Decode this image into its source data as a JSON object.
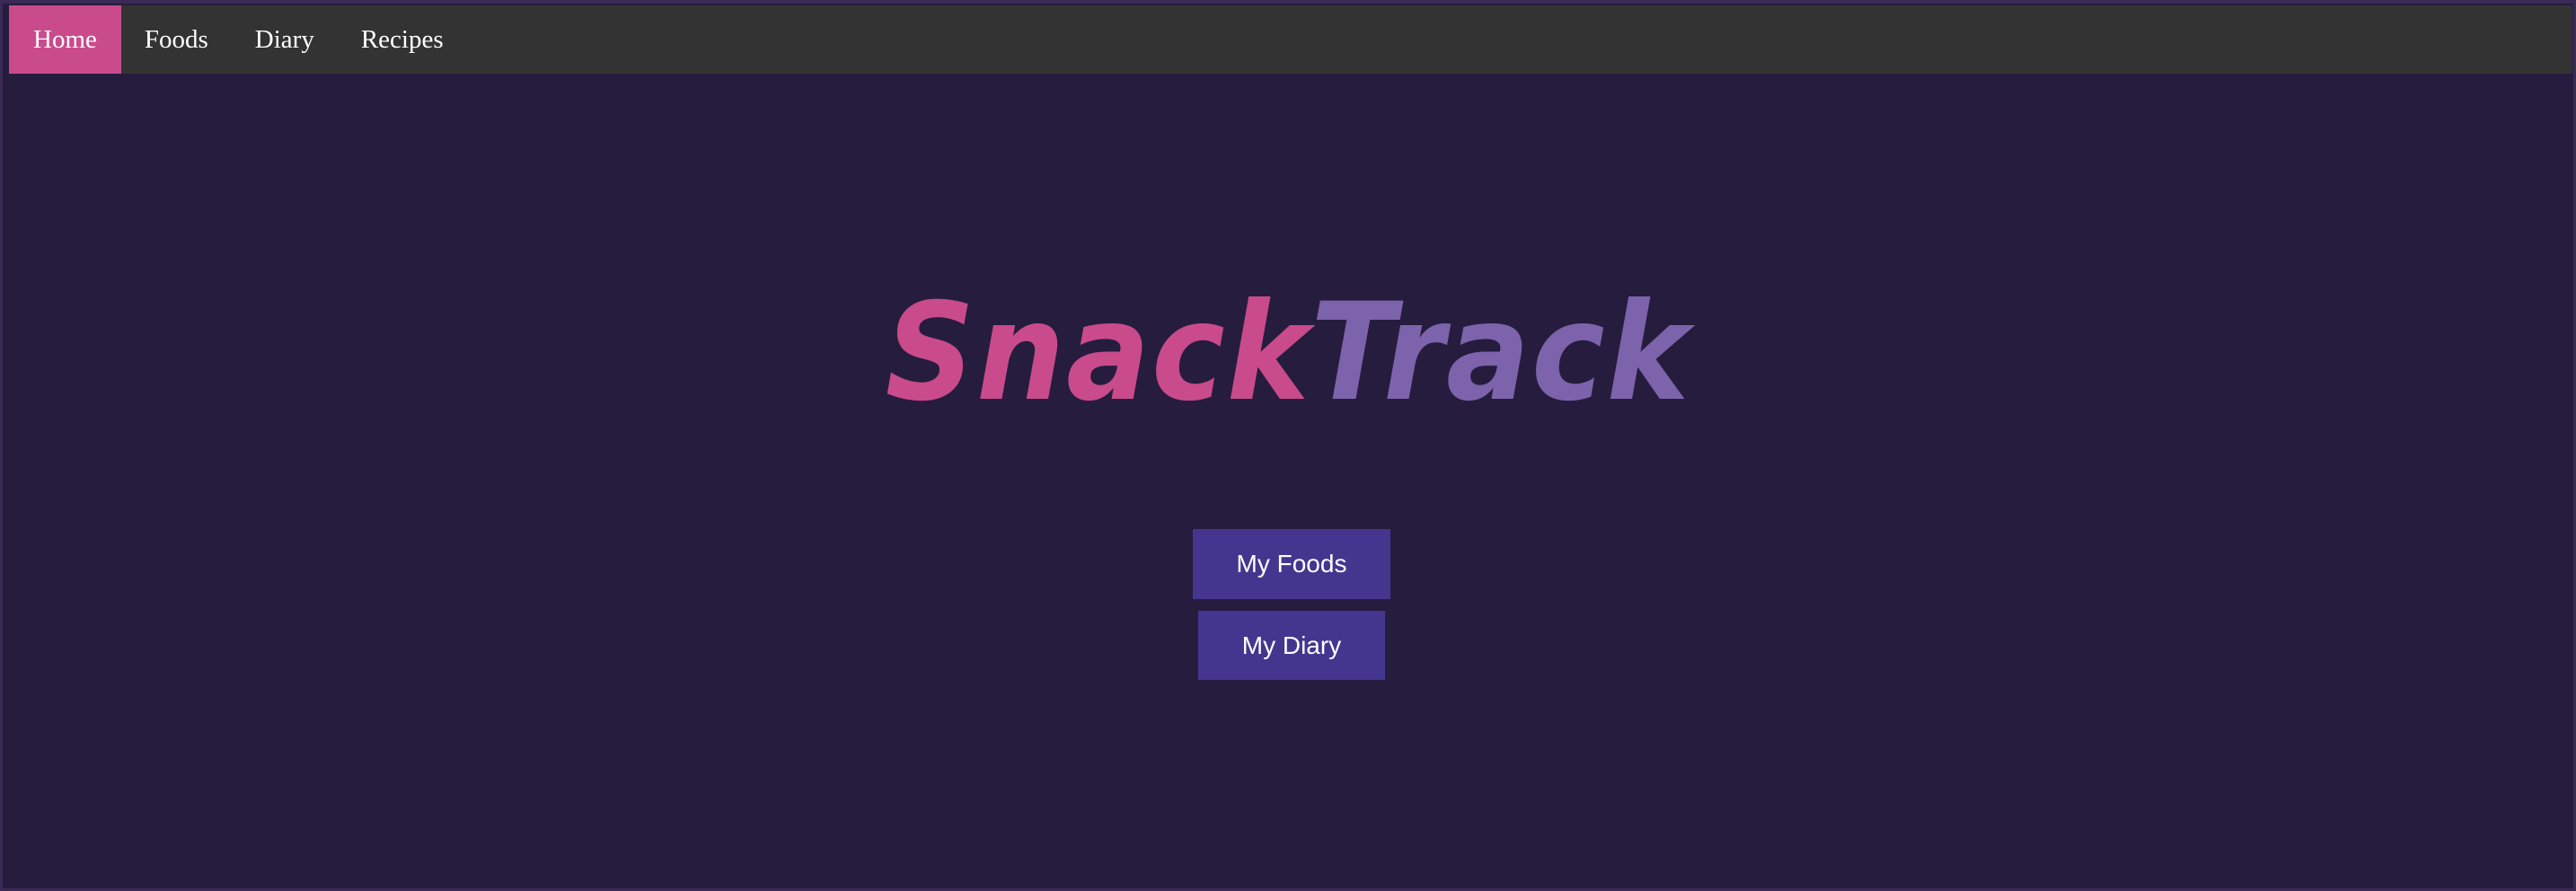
{
  "nav": {
    "items": [
      {
        "label": "Home",
        "active": true
      },
      {
        "label": "Foods",
        "active": false
      },
      {
        "label": "Diary",
        "active": false
      },
      {
        "label": "Recipes",
        "active": false
      }
    ]
  },
  "logo": {
    "part1": "Snack",
    "part2": "Track"
  },
  "buttons": {
    "my_foods": "My Foods",
    "my_diary": "My Diary"
  },
  "colors": {
    "background": "#261c3e",
    "navbar": "#333333",
    "active_nav": "#c94b8c",
    "logo_pink": "#c94b8c",
    "logo_purple": "#7d63ab",
    "button": "#44368f"
  }
}
